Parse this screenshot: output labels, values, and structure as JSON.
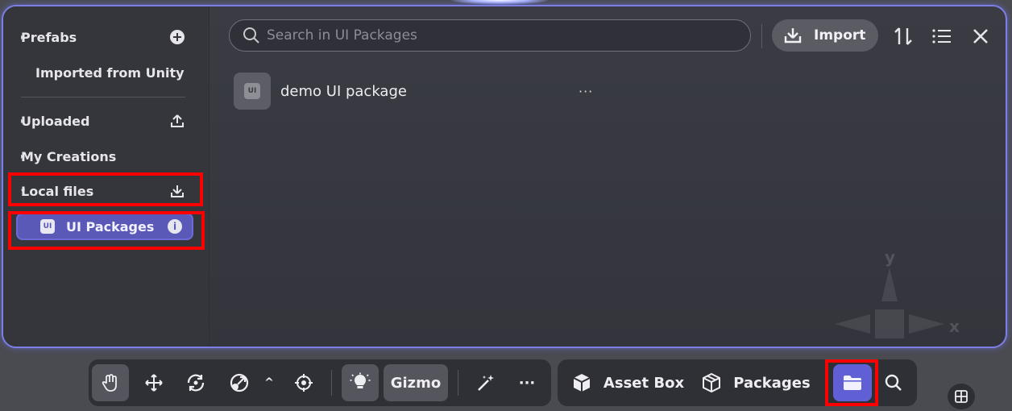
{
  "sidebar": {
    "items": [
      {
        "label": "Prefabs",
        "caret": "▸",
        "right_icon": "add-circle-icon"
      },
      {
        "label": "Imported from Unity",
        "caret": "",
        "right_icon": ""
      },
      {
        "label": "Uploaded",
        "caret": "▸",
        "right_icon": "upload-icon"
      },
      {
        "label": "My Creations",
        "caret": "▸",
        "right_icon": ""
      },
      {
        "label": "Local files",
        "caret": "▾",
        "right_icon": "import-icon"
      }
    ],
    "selected": {
      "label": "UI Packages",
      "icon_text": "UI",
      "info": "i"
    }
  },
  "search": {
    "placeholder": "Search in UI Packages",
    "value": ""
  },
  "header": {
    "import_label": "Import"
  },
  "packages": [
    {
      "name": "demo UI package",
      "icon_text": "UI",
      "more": "···"
    }
  ],
  "gizmo": {
    "y_label": "y",
    "x_label": "x"
  },
  "toolbar": {
    "gizmo_label": "Gizmo",
    "more": "···",
    "caret": "^",
    "asset_box_label": "Asset Box",
    "packages_label": "Packages"
  },
  "colors": {
    "accent": "#6060d4",
    "highlight": "#ff0000",
    "panel_border": "#7d7fe6"
  }
}
